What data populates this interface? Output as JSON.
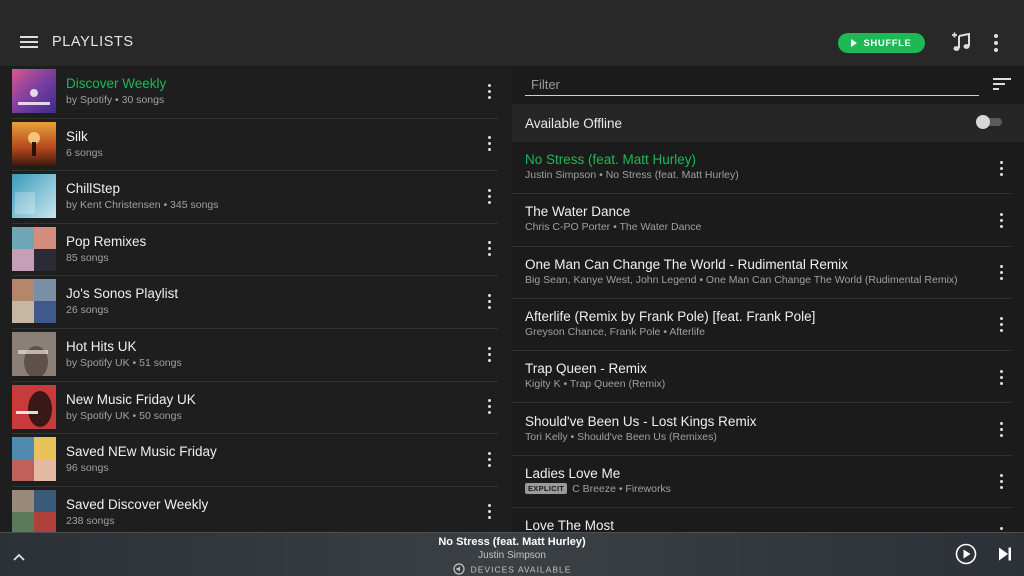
{
  "header": {
    "title": "PLAYLISTS",
    "shuffle_label": "SHUFFLE",
    "accent": "#1db954"
  },
  "playlists": [
    {
      "name": "Discover Weekly",
      "sub": "by Spotify • 30 songs",
      "active": true
    },
    {
      "name": "Silk",
      "sub": "6 songs",
      "active": false
    },
    {
      "name": "ChillStep",
      "sub": "by Kent Christensen • 345 songs",
      "active": false
    },
    {
      "name": "Pop Remixes",
      "sub": "85 songs",
      "active": false
    },
    {
      "name": "Jo's Sonos Playlist",
      "sub": "26 songs",
      "active": false
    },
    {
      "name": "Hot Hits UK",
      "sub": "by Spotify UK • 51 songs",
      "active": false
    },
    {
      "name": "New Music Friday UK",
      "sub": "by Spotify UK • 50 songs",
      "active": false
    },
    {
      "name": "Saved NEw Music Friday",
      "sub": "96 songs",
      "active": false
    },
    {
      "name": "Saved Discover Weekly",
      "sub": "238 songs",
      "active": false
    }
  ],
  "filter": {
    "placeholder": "Filter",
    "value": ""
  },
  "offline": {
    "label": "Available Offline",
    "enabled": false
  },
  "tracks": [
    {
      "title": "No Stress (feat. Matt Hurley)",
      "sub": "Justin Simpson • No Stress (feat. Matt Hurley)",
      "active": true,
      "explicit": false
    },
    {
      "title": "The Water Dance",
      "sub": "Chris C-PO Porter • The Water Dance",
      "active": false,
      "explicit": false
    },
    {
      "title": "One Man Can Change The World - Rudimental Remix",
      "sub": "Big Sean, Kanye West, John Legend • One Man Can Change The World (Rudimental Remix)",
      "active": false,
      "explicit": false
    },
    {
      "title": "Afterlife (Remix by Frank Pole) [feat. Frank Pole]",
      "sub": "Greyson Chance, Frank Pole • Afterlife",
      "active": false,
      "explicit": false
    },
    {
      "title": "Trap Queen - Remix",
      "sub": "Kigity K • Trap Queen (Remix)",
      "active": false,
      "explicit": false
    },
    {
      "title": "Should've Been Us - Lost Kings Remix",
      "sub": "Tori Kelly • Should've Been Us (Remixes)",
      "active": false,
      "explicit": false
    },
    {
      "title": "Ladies Love Me",
      "sub": "C Breeze • Fireworks",
      "active": false,
      "explicit": true,
      "explicit_label": "EXPLICIT"
    },
    {
      "title": "Love The Most",
      "sub": "",
      "active": false,
      "explicit": false
    }
  ],
  "now_playing": {
    "title": "No Stress (feat. Matt Hurley)",
    "artist": "Justin Simpson",
    "devices": "DEVICES AVAILABLE"
  },
  "icons": {
    "menu": "hamburger-icon",
    "add_music": "add-music-icon",
    "more": "more-vert-icon",
    "sort": "sort-icon",
    "play": "play-circle-icon",
    "next": "skip-next-icon",
    "expand": "chevron-up-icon",
    "speaker": "speaker-icon"
  }
}
